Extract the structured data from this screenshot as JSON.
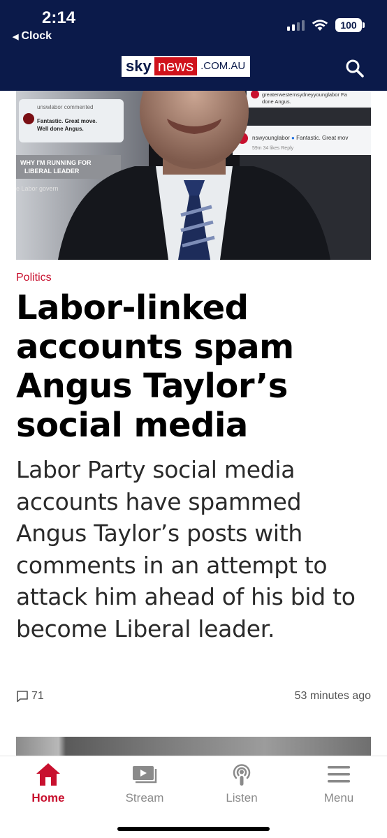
{
  "status_bar": {
    "time": "2:14",
    "back_label": "Clock",
    "battery": "100"
  },
  "header": {
    "logo": {
      "sky": "sky",
      "news": "news",
      "domain": ".COM.AU"
    },
    "search_icon": "search-icon"
  },
  "hero_image": {
    "overlay_texts": {
      "comment_user_1": "unswlabor commented",
      "comment_text_1": "Fantastic. Great move. Well done Angus.",
      "banner": "WHY I'M RUNNING FOR LIBERAL LEADER",
      "ticker": "e Labor govern",
      "top_right_user": "greaterwesternsydneyyounglabor Fa",
      "top_right_text": "done Angus.",
      "reply_user": "nswyounglabor",
      "reply_text": "Fantastic. Great mov",
      "reply_meta": "59m   34 likes   Reply"
    }
  },
  "article": {
    "category": "Politics",
    "headline": "Labor-linked accounts spam Angus Taylor’s social media",
    "standfirst": "Labor Party social media accounts have spammed Angus Taylor’s posts with comments in an attempt to attack him ahead of his bid to become Liberal leader.",
    "comment_count": "71",
    "timestamp": "53 minutes ago"
  },
  "tabbar": {
    "items": [
      {
        "label": "Home",
        "icon": "home-icon",
        "active": true
      },
      {
        "label": "Stream",
        "icon": "stream-icon",
        "active": false
      },
      {
        "label": "Listen",
        "icon": "podcast-icon",
        "active": false
      },
      {
        "label": "Menu",
        "icon": "menu-icon",
        "active": false
      }
    ]
  },
  "colors": {
    "header_bg": "#0b1a4a",
    "accent_red": "#c8102e",
    "tab_inactive": "#8a8a8a"
  }
}
